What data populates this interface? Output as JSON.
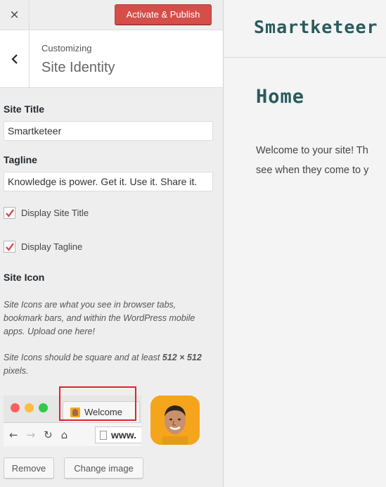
{
  "topbar": {
    "close_icon": "×",
    "publish_label": "Activate & Publish"
  },
  "section": {
    "customizing_label": "Customizing",
    "title": "Site Identity"
  },
  "site_title": {
    "label": "Site Title",
    "value": "Smartketeer"
  },
  "tagline": {
    "label": "Tagline",
    "value": "Knowledge is power. Get it. Use it. Share it."
  },
  "display_site_title": {
    "label": "Display Site Title",
    "checked": true
  },
  "display_tagline": {
    "label": "Display Tagline",
    "checked": true
  },
  "site_icon": {
    "label": "Site Icon",
    "desc1": "Site Icons are what you see in browser tabs, bookmark bars, and within the WordPress mobile apps. Upload one here!",
    "desc2_prefix": "Site Icons should be square and at least ",
    "desc2_size": "512 × 512",
    "desc2_suffix": " pixels.",
    "tab_label": "Welcome",
    "url_text": "www.",
    "nav_icons": [
      "back-arrow",
      "forward-arrow",
      "reload",
      "home"
    ]
  },
  "buttons": {
    "remove_label": "Remove",
    "change_label": "Change image"
  },
  "preview": {
    "site_name": "Smartketeer",
    "page_heading": "Home",
    "welcome_line1": "Welcome to your site! Th",
    "welcome_line2": "see when they come to y"
  },
  "colors": {
    "publish": "#d54e4a",
    "checkmark": "#d54e4a",
    "brand_teal": "#2a5a5e",
    "highlight": "#e0232b",
    "app_icon": "#f5a51c",
    "dot_red": "#fc605c",
    "dot_yellow": "#fdbc40",
    "dot_green": "#34c84a"
  }
}
